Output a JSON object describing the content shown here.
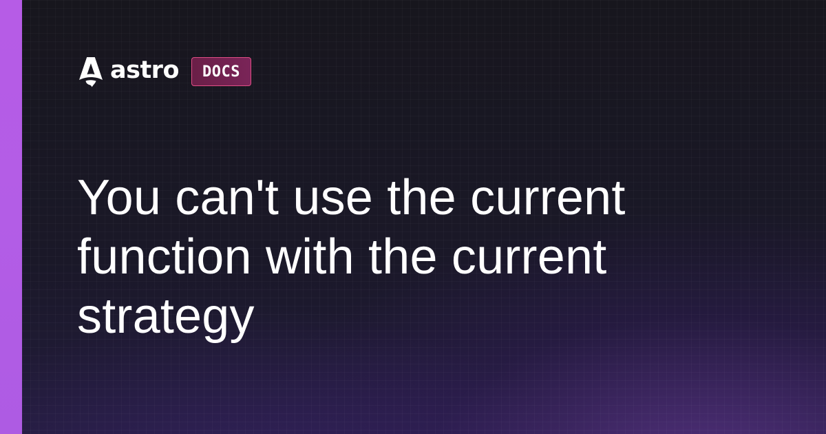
{
  "brand": {
    "wordmark": "astro",
    "badge": "DOCS",
    "logo_icon": "astro-rocket-icon"
  },
  "headline": {
    "text": "You can't use the current function with the current strategy"
  },
  "colors": {
    "accent_bar": "#b65ce6",
    "background": "#16161d",
    "badge_border": "#e14e86",
    "badge_fill": "#6a1f47",
    "text": "#ffffff"
  }
}
